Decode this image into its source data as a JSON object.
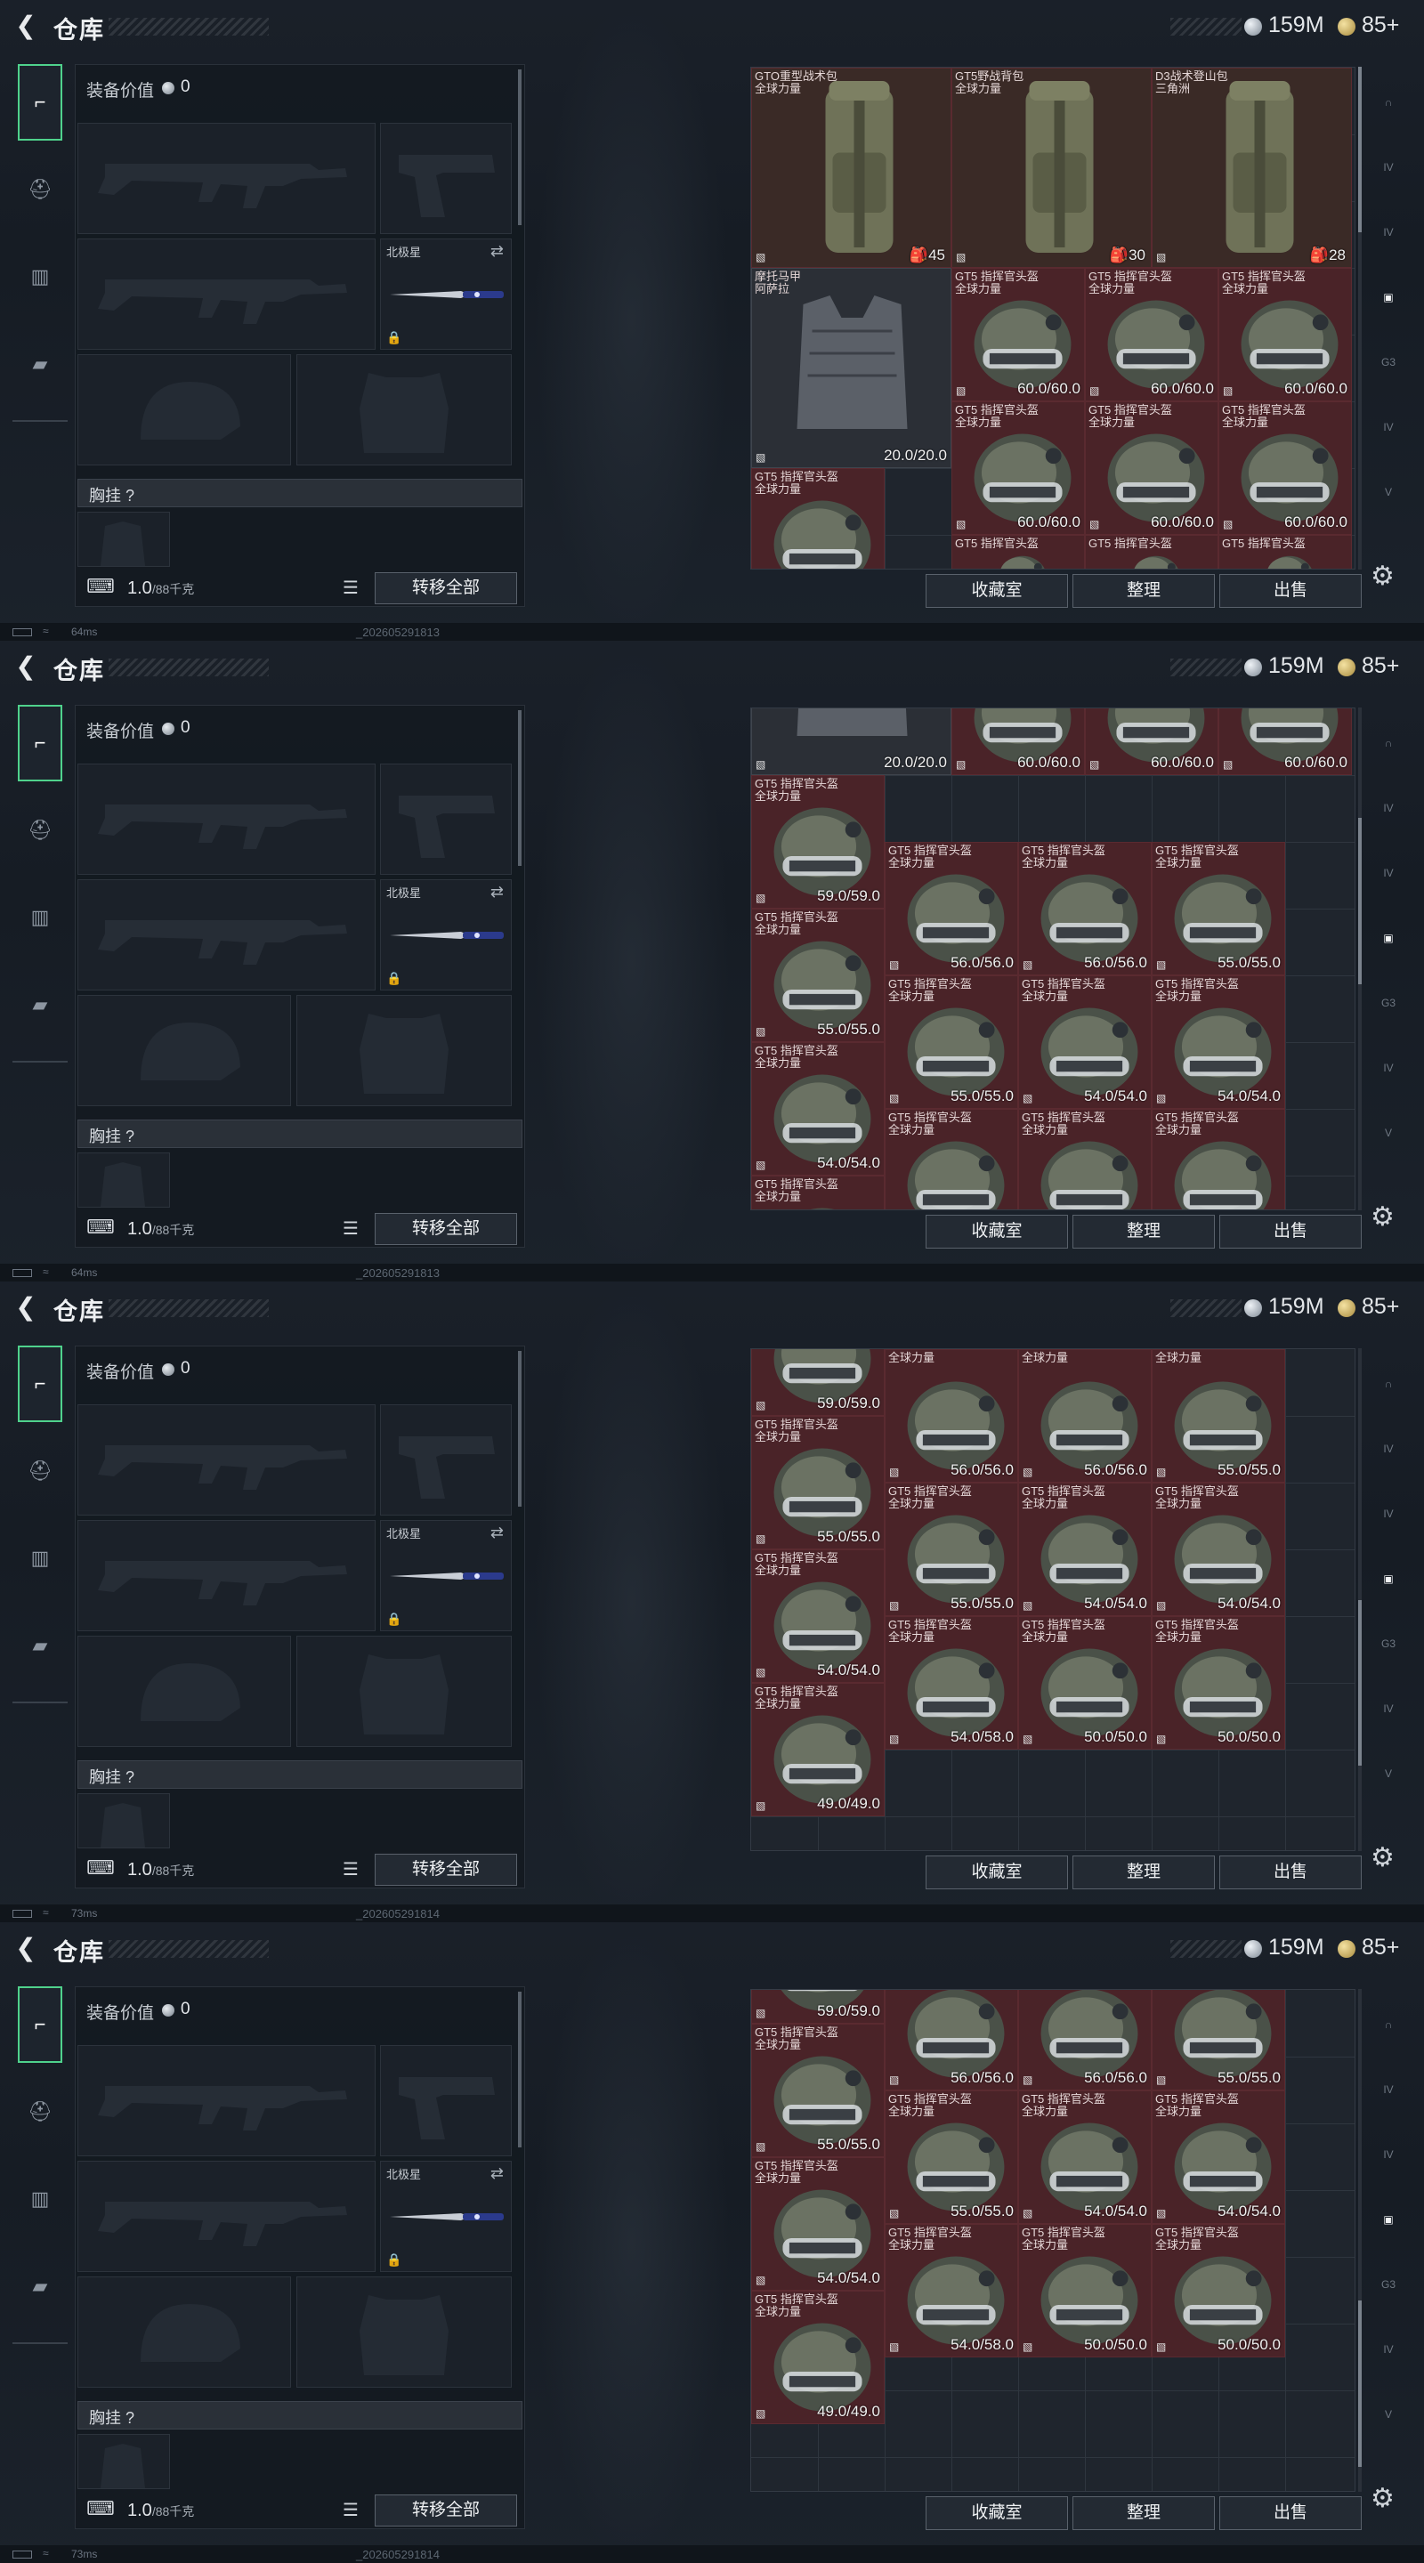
{
  "header": {
    "title": "仓库",
    "silver": "159M",
    "gold": "85+"
  },
  "left_tabs": [
    {
      "name": "weapon-tab",
      "glyph": "⌐",
      "active": true
    },
    {
      "name": "helmet-tab",
      "glyph": "⛑",
      "active": false
    },
    {
      "name": "vest-tab",
      "glyph": "▥",
      "active": false
    },
    {
      "name": "bag-tab",
      "glyph": "▰",
      "active": false
    }
  ],
  "equip": {
    "value_label": "装备价值",
    "value": "0",
    "melee_label": "北极星",
    "vest_label": "胸挂 ?",
    "weight": "1.0",
    "weight_max": "/88千克",
    "transfer_label": "转移全部"
  },
  "buttons": {
    "collection": "收藏室",
    "sort": "整理",
    "sell": "出售"
  },
  "right_tabs": [
    "∩",
    "IV",
    "IV",
    "▣",
    "G3",
    "IV",
    "V"
  ],
  "frames": [
    {
      "ping": "64ms",
      "build": "_202605291813",
      "scroll": {
        "top": 0.0,
        "size": 0.33
      },
      "items": [
        {
          "type": "pack",
          "name": "GTO重型战术包\n全球力量",
          "cap": "45",
          "col": 0,
          "row": 0,
          "w": 3,
          "h": 3,
          "tone": "green"
        },
        {
          "type": "pack",
          "name": "GT5野战背包\n全球力量",
          "cap": "30",
          "col": 3,
          "row": 0,
          "w": 3,
          "h": 3,
          "tone": "green"
        },
        {
          "type": "pack",
          "name": "D3战术登山包\n三角洲",
          "cap": "28",
          "col": 6,
          "row": 0,
          "w": 3,
          "h": 3,
          "tone": "green"
        },
        {
          "type": "vest",
          "name": "摩托马甲\n阿萨拉",
          "dura": "20.0/20.0",
          "col": 0,
          "row": 3,
          "w": 3,
          "h": 3
        },
        {
          "type": "helmet",
          "name": "GT5 指挥官头盔\n全球力量",
          "dura": "60.0/60.0",
          "col": 3,
          "row": 3,
          "w": 2,
          "h": 2
        },
        {
          "type": "helmet",
          "name": "GT5 指挥官头盔\n全球力量",
          "dura": "60.0/60.0",
          "col": 5,
          "row": 3,
          "w": 2,
          "h": 2
        },
        {
          "type": "helmet",
          "name": "GT5 指挥官头盔\n全球力量",
          "dura": "60.0/60.0",
          "col": 7,
          "row": 3,
          "w": 2,
          "h": 2
        },
        {
          "type": "helmet",
          "name": "GT5 指挥官头盔\n全球力量",
          "dura": "60.0/60.0",
          "col": 3,
          "row": 5,
          "w": 2,
          "h": 2
        },
        {
          "type": "helmet",
          "name": "GT5 指挥官头盔\n全球力量",
          "dura": "60.0/60.0",
          "col": 5,
          "row": 5,
          "w": 2,
          "h": 2
        },
        {
          "type": "helmet",
          "name": "GT5 指挥官头盔\n全球力量",
          "dura": "60.0/60.0",
          "col": 7,
          "row": 5,
          "w": 2,
          "h": 2
        },
        {
          "type": "helmet",
          "name": "GT5 指挥官头盔\n全球力量",
          "dura": "",
          "col": 0,
          "row": 6,
          "w": 2,
          "h": 2
        },
        {
          "type": "helmet",
          "name": "GT5 指挥官头盔",
          "dura": "",
          "col": 3,
          "row": 7,
          "w": 2,
          "h": 1
        },
        {
          "type": "helmet",
          "name": "GT5 指挥官头盔",
          "dura": "",
          "col": 5,
          "row": 7,
          "w": 2,
          "h": 1
        },
        {
          "type": "helmet",
          "name": "GT5 指挥官头盔",
          "dura": "",
          "col": 7,
          "row": 7,
          "w": 2,
          "h": 1
        }
      ]
    },
    {
      "ping": "64ms",
      "build": "_202605291813",
      "scroll": {
        "top": 0.22,
        "size": 0.33
      },
      "items": [
        {
          "type": "vest",
          "name": "",
          "dura": "20.0/20.0",
          "col": 0,
          "row": -2,
          "w": 3,
          "h": 3
        },
        {
          "type": "helmet",
          "name": "",
          "dura": "60.0/60.0",
          "col": 3,
          "row": -1,
          "w": 2,
          "h": 2
        },
        {
          "type": "helmet",
          "name": "",
          "dura": "60.0/60.0",
          "col": 5,
          "row": -1,
          "w": 2,
          "h": 2
        },
        {
          "type": "helmet",
          "name": "",
          "dura": "60.0/60.0",
          "col": 7,
          "row": -1,
          "w": 2,
          "h": 2
        },
        {
          "type": "helmet",
          "name": "GT5 指挥官头盔\n全球力量",
          "dura": "59.0/59.0",
          "col": 0,
          "row": 1,
          "w": 2,
          "h": 2
        },
        {
          "type": "helmet",
          "name": "GT5 指挥官头盔\n全球力量",
          "dura": "56.0/56.0",
          "col": 2,
          "row": 2,
          "w": 2,
          "h": 2
        },
        {
          "type": "helmet",
          "name": "GT5 指挥官头盔\n全球力量",
          "dura": "56.0/56.0",
          "col": 4,
          "row": 2,
          "w": 2,
          "h": 2
        },
        {
          "type": "helmet",
          "name": "GT5 指挥官头盔\n全球力量",
          "dura": "55.0/55.0",
          "col": 6,
          "row": 2,
          "w": 2,
          "h": 2
        },
        {
          "type": "helmet",
          "name": "GT5 指挥官头盔\n全球力量",
          "dura": "55.0/55.0",
          "col": 0,
          "row": 3,
          "w": 2,
          "h": 2
        },
        {
          "type": "helmet",
          "name": "GT5 指挥官头盔\n全球力量",
          "dura": "55.0/55.0",
          "col": 2,
          "row": 4,
          "w": 2,
          "h": 2
        },
        {
          "type": "helmet",
          "name": "GT5 指挥官头盔\n全球力量",
          "dura": "54.0/54.0",
          "col": 4,
          "row": 4,
          "w": 2,
          "h": 2
        },
        {
          "type": "helmet",
          "name": "GT5 指挥官头盔\n全球力量",
          "dura": "54.0/54.0",
          "col": 6,
          "row": 4,
          "w": 2,
          "h": 2
        },
        {
          "type": "helmet",
          "name": "GT5 指挥官头盔\n全球力量",
          "dura": "54.0/54.0",
          "col": 0,
          "row": 5,
          "w": 2,
          "h": 2
        },
        {
          "type": "helmet",
          "name": "GT5 指挥官头盔\n全球力量",
          "dura": "54.0/58.0",
          "col": 2,
          "row": 6,
          "w": 2,
          "h": 2
        },
        {
          "type": "helmet",
          "name": "GT5 指挥官头盔\n全球力量",
          "dura": "50.0/50.0",
          "col": 4,
          "row": 6,
          "w": 2,
          "h": 2
        },
        {
          "type": "helmet",
          "name": "GT5 指挥官头盔\n全球力量",
          "dura": "50.0/50.0",
          "col": 6,
          "row": 6,
          "w": 2,
          "h": 2
        },
        {
          "type": "helmet",
          "name": "GT5 指挥官头盔\n全球力量",
          "dura": "",
          "col": 0,
          "row": 7,
          "w": 2,
          "h": 2
        }
      ]
    },
    {
      "ping": "73ms",
      "build": "_202605291814",
      "scroll": {
        "top": 0.5,
        "size": 0.33
      },
      "items": [
        {
          "type": "helmet",
          "name": "",
          "dura": "59.0/59.0",
          "col": 0,
          "row": -1,
          "w": 2,
          "h": 2
        },
        {
          "type": "helmet",
          "name": "全球力量",
          "dura": "56.0/56.0",
          "col": 2,
          "row": 0,
          "w": 2,
          "h": 2
        },
        {
          "type": "helmet",
          "name": "全球力量",
          "dura": "56.0/56.0",
          "col": 4,
          "row": 0,
          "w": 2,
          "h": 2
        },
        {
          "type": "helmet",
          "name": "全球力量",
          "dura": "55.0/55.0",
          "col": 6,
          "row": 0,
          "w": 2,
          "h": 2
        },
        {
          "type": "helmet",
          "name": "GT5 指挥官头盔\n全球力量",
          "dura": "55.0/55.0",
          "col": 0,
          "row": 1,
          "w": 2,
          "h": 2
        },
        {
          "type": "helmet",
          "name": "GT5 指挥官头盔\n全球力量",
          "dura": "55.0/55.0",
          "col": 2,
          "row": 2,
          "w": 2,
          "h": 2
        },
        {
          "type": "helmet",
          "name": "GT5 指挥官头盔\n全球力量",
          "dura": "54.0/54.0",
          "col": 4,
          "row": 2,
          "w": 2,
          "h": 2
        },
        {
          "type": "helmet",
          "name": "GT5 指挥官头盔\n全球力量",
          "dura": "54.0/54.0",
          "col": 6,
          "row": 2,
          "w": 2,
          "h": 2
        },
        {
          "type": "helmet",
          "name": "GT5 指挥官头盔\n全球力量",
          "dura": "54.0/54.0",
          "col": 0,
          "row": 3,
          "w": 2,
          "h": 2
        },
        {
          "type": "helmet",
          "name": "GT5 指挥官头盔\n全球力量",
          "dura": "54.0/58.0",
          "col": 2,
          "row": 4,
          "w": 2,
          "h": 2
        },
        {
          "type": "helmet",
          "name": "GT5 指挥官头盔\n全球力量",
          "dura": "50.0/50.0",
          "col": 4,
          "row": 4,
          "w": 2,
          "h": 2
        },
        {
          "type": "helmet",
          "name": "GT5 指挥官头盔\n全球力量",
          "dura": "50.0/50.0",
          "col": 6,
          "row": 4,
          "w": 2,
          "h": 2
        },
        {
          "type": "helmet",
          "name": "GT5 指挥官头盔\n全球力量",
          "dura": "49.0/49.0",
          "col": 0,
          "row": 5,
          "w": 2,
          "h": 2
        }
      ]
    },
    {
      "ping": "73ms",
      "build": "_202605291814",
      "scroll": {
        "top": 0.62,
        "size": 0.33
      },
      "items": [
        {
          "type": "helmet",
          "name": "",
          "dura": "59.0/59.0",
          "col": 0,
          "row": -1.5,
          "w": 2,
          "h": 2
        },
        {
          "type": "helmet",
          "name": "",
          "dura": "56.0/56.0",
          "col": 2,
          "row": -0.5,
          "w": 2,
          "h": 2
        },
        {
          "type": "helmet",
          "name": "",
          "dura": "56.0/56.0",
          "col": 4,
          "row": -0.5,
          "w": 2,
          "h": 2
        },
        {
          "type": "helmet",
          "name": "",
          "dura": "55.0/55.0",
          "col": 6,
          "row": -0.5,
          "w": 2,
          "h": 2
        },
        {
          "type": "helmet",
          "name": "GT5 指挥官头盔\n全球力量",
          "dura": "55.0/55.0",
          "col": 0,
          "row": 0.5,
          "w": 2,
          "h": 2
        },
        {
          "type": "helmet",
          "name": "GT5 指挥官头盔\n全球力量",
          "dura": "55.0/55.0",
          "col": 2,
          "row": 1.5,
          "w": 2,
          "h": 2
        },
        {
          "type": "helmet",
          "name": "GT5 指挥官头盔\n全球力量",
          "dura": "54.0/54.0",
          "col": 4,
          "row": 1.5,
          "w": 2,
          "h": 2
        },
        {
          "type": "helmet",
          "name": "GT5 指挥官头盔\n全球力量",
          "dura": "54.0/54.0",
          "col": 6,
          "row": 1.5,
          "w": 2,
          "h": 2
        },
        {
          "type": "helmet",
          "name": "GT5 指挥官头盔\n全球力量",
          "dura": "54.0/54.0",
          "col": 0,
          "row": 2.5,
          "w": 2,
          "h": 2
        },
        {
          "type": "helmet",
          "name": "GT5 指挥官头盔\n全球力量",
          "dura": "54.0/58.0",
          "col": 2,
          "row": 3.5,
          "w": 2,
          "h": 2
        },
        {
          "type": "helmet",
          "name": "GT5 指挥官头盔\n全球力量",
          "dura": "50.0/50.0",
          "col": 4,
          "row": 3.5,
          "w": 2,
          "h": 2
        },
        {
          "type": "helmet",
          "name": "GT5 指挥官头盔\n全球力量",
          "dura": "50.0/50.0",
          "col": 6,
          "row": 3.5,
          "w": 2,
          "h": 2
        },
        {
          "type": "helmet",
          "name": "GT5 指挥官头盔\n全球力量",
          "dura": "49.0/49.0",
          "col": 0,
          "row": 4.5,
          "w": 2,
          "h": 2
        }
      ]
    }
  ]
}
